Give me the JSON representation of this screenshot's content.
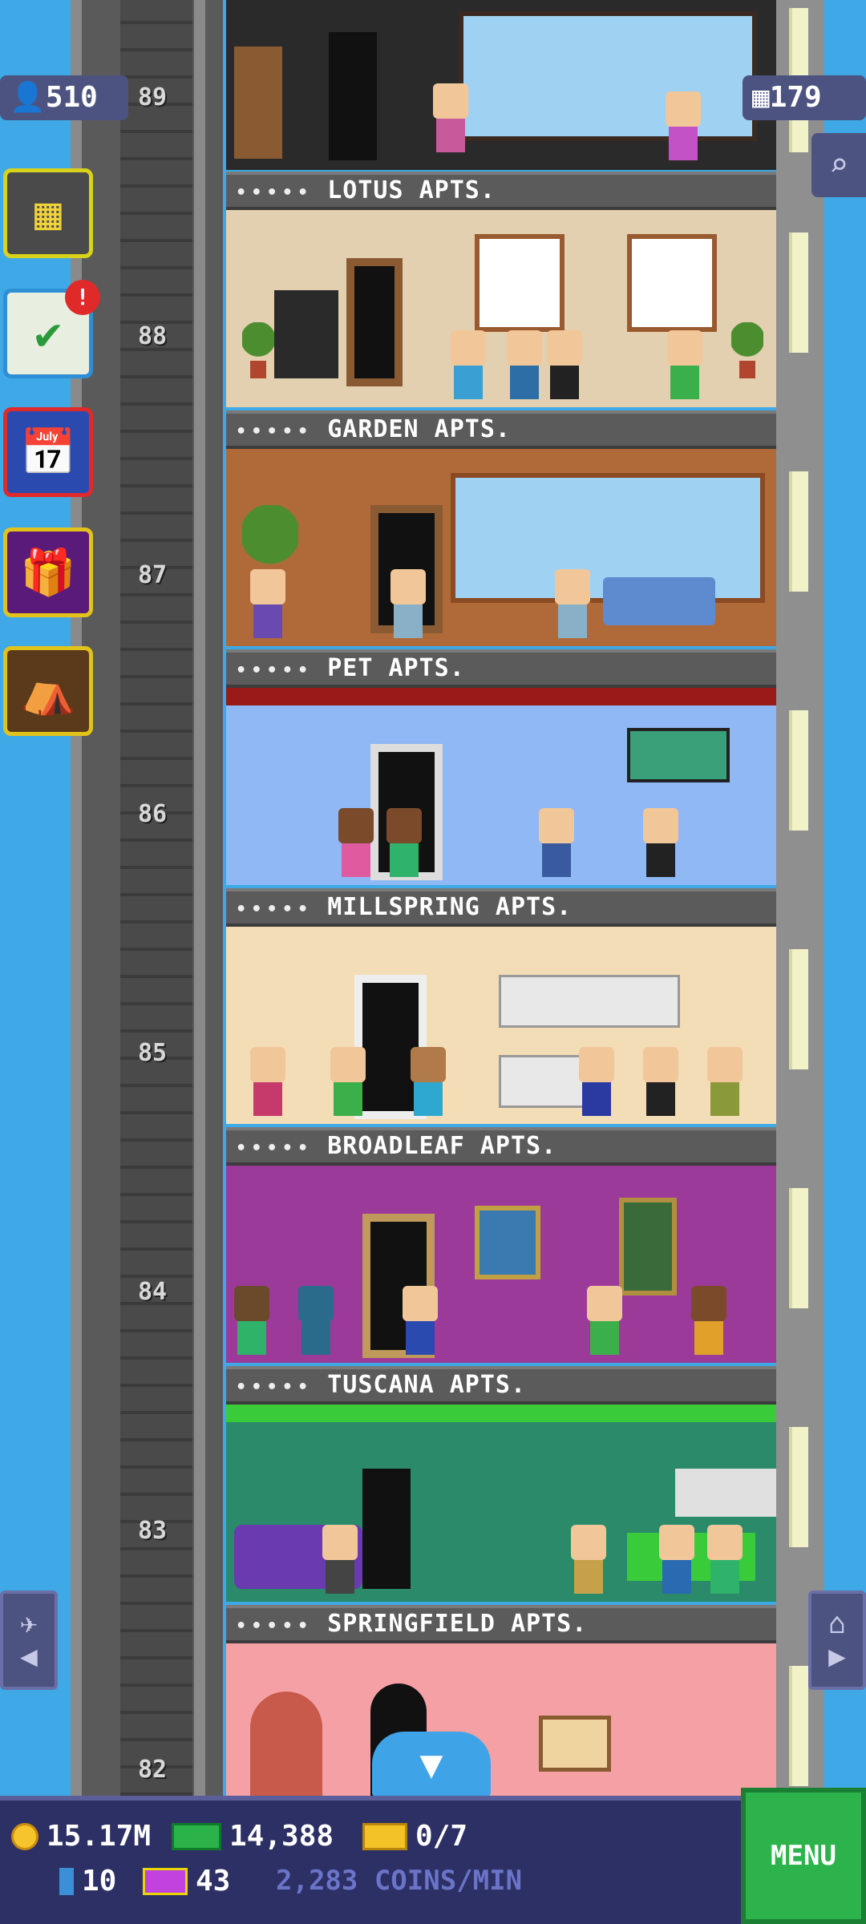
{
  "top_counters": {
    "population": "510",
    "floors": "179"
  },
  "floors": [
    {
      "number": "89",
      "name": ""
    },
    {
      "number": "88",
      "name": "LOTUS APTS."
    },
    {
      "number": "87",
      "name": "GARDEN APTS."
    },
    {
      "number": "86",
      "name": "PET APTS."
    },
    {
      "number": "85",
      "name": "MILLSPRING APTS."
    },
    {
      "number": "84",
      "name": "BROADLEAF APTS."
    },
    {
      "number": "83",
      "name": "TUSCANA APTS."
    },
    {
      "number": "82",
      "name": "SPRINGFIELD APTS."
    }
  ],
  "rating_dots": "•••••",
  "side_buttons": [
    "build-floor",
    "missions",
    "calendar",
    "gift",
    "market"
  ],
  "mission_badge": "!",
  "bottom_bar": {
    "coins": "15.17M",
    "bux": "14,388",
    "tickets": "0/7",
    "bitizen_count": "10",
    "vip_count": "43",
    "income": "2,283 COINS/MIN",
    "menu_label": "MENU"
  },
  "colors": {
    "sky": "#3ea9e6",
    "bar": "#2d3064",
    "menu": "#2db34b"
  }
}
